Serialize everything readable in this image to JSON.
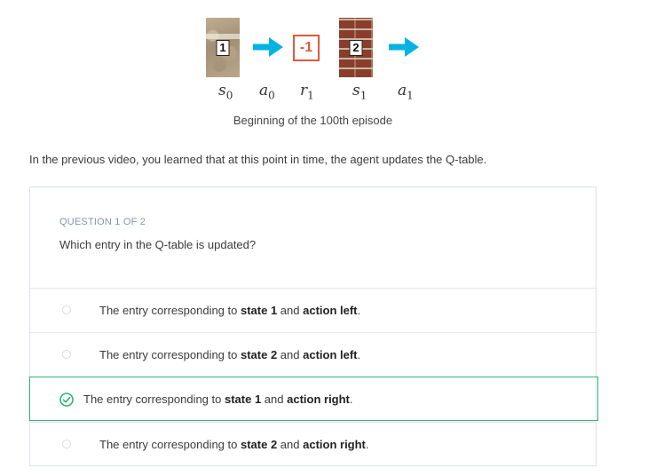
{
  "figure": {
    "state0_number": "1",
    "reward_value": "-1",
    "state1_number": "2",
    "symbols": {
      "s0": {
        "base": "s",
        "sub": "0"
      },
      "a0": {
        "base": "a",
        "sub": "0"
      },
      "r1": {
        "base": "r",
        "sub": "1"
      },
      "s1": {
        "base": "s",
        "sub": "1"
      },
      "a1": {
        "base": "a",
        "sub": "1"
      }
    },
    "caption": "Beginning of the 100th episode",
    "colors": {
      "arrow": "#02b3e4",
      "reward": "#e3573f"
    }
  },
  "intro_text": "In the previous video, you learned that at this point in time, the agent updates the Q-table.",
  "quiz": {
    "label": "QUESTION 1 OF 2",
    "question": "Which entry in the Q-table is updated?",
    "prefix": "The entry corresponding to ",
    "options": [
      {
        "state": "state 1",
        "and": " and ",
        "action": "action left",
        "end": ".",
        "selected": false
      },
      {
        "state": "state 2",
        "and": " and ",
        "action": "action left",
        "end": ".",
        "selected": false
      },
      {
        "state": "state 1",
        "and": " and ",
        "action": "action right",
        "end": ".",
        "selected": true
      },
      {
        "state": "state 2",
        "and": " and ",
        "action": "action right",
        "end": ".",
        "selected": false
      }
    ],
    "colors": {
      "selected_border": "#2bb673",
      "label": "#7d97ad"
    }
  }
}
